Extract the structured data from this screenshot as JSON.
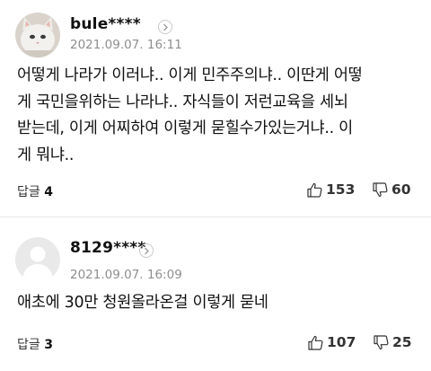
{
  "comments": [
    {
      "username": "bule****",
      "date": "2021.09.07. 16:11",
      "text": "어떻게 나라가 이러냐.. 이게 민주주의냐.. 이딴게 어떻\n게 국민을위하는 나라냐.. 자식들이 저런교육을 세뇌\n받는데, 이게 어찌하여 이렇게 묻힐수가있는거냐.. 이\n게 뭐냐..",
      "reply_label": "답글",
      "reply_count": "4",
      "likes": "153",
      "dislikes": "60",
      "avatar": "white-cat-photo"
    },
    {
      "username": "8129****",
      "date": "2021.09.07. 16:09",
      "text": "애초에 30만 청원올라온걸 이렇게 묻네",
      "reply_label": "답글",
      "reply_count": "3",
      "likes": "107",
      "dislikes": "25",
      "avatar": "default-person-silhouette"
    }
  ],
  "colors": {
    "text": "#111111",
    "muted": "#8e8e8e",
    "divider": "#e6e6e6"
  },
  "icons": [
    "thumbs-up-icon",
    "thumbs-down-icon",
    "chevron-right-icon"
  ]
}
